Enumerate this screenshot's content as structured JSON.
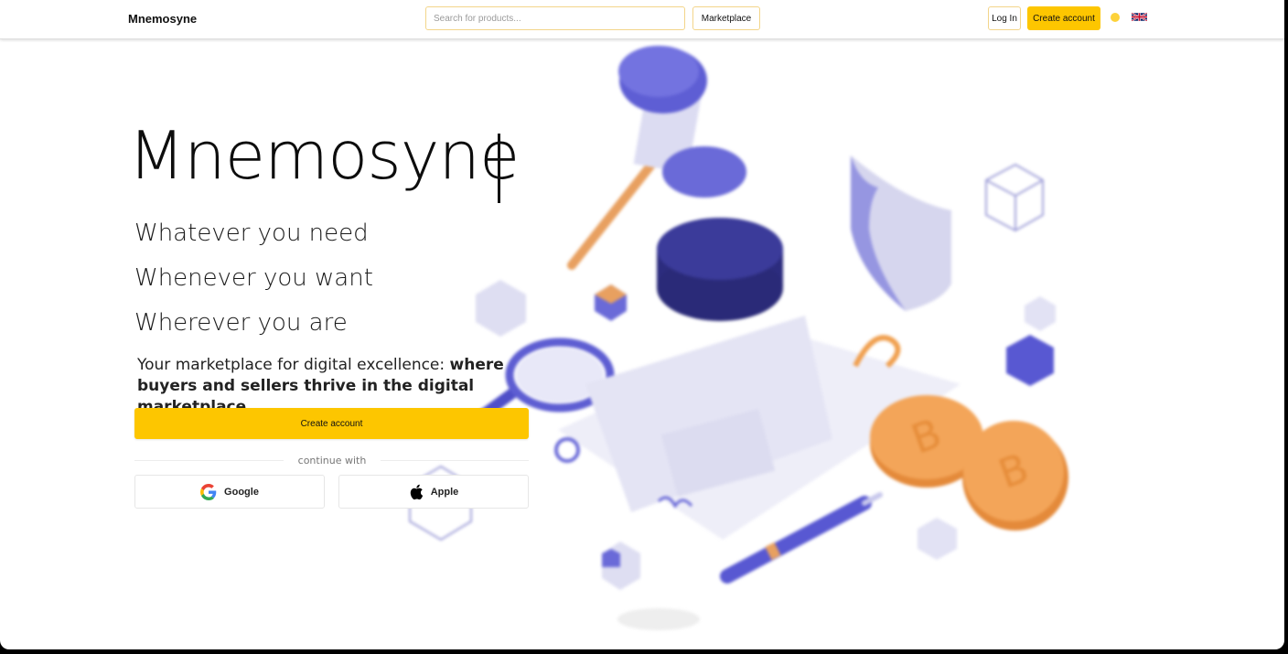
{
  "header": {
    "brand": "Mnemosyne",
    "search_placeholder": "Search for products...",
    "marketplace_label": "Marketplace",
    "login_label": "Log In",
    "create_account_label": "Create account",
    "theme_icon": "sun-dot-icon",
    "language_icon": "uk-flag-icon"
  },
  "hero": {
    "title": "Mnemosyne",
    "lines": [
      "Whatever you need",
      "Whenever you want",
      "Wherever you are"
    ],
    "tagline_plain": "Your marketplace for digital excellence: ",
    "tagline_bold": "where buyers and sellers thrive in the digital marketplace.",
    "cta_label": "Create account",
    "continue_with": "continue with",
    "google_label": "Google",
    "apple_label": "Apple"
  },
  "colors": {
    "accent": "#fdc600",
    "illustration_primary": "#5b5bd6",
    "coin": "#f0a050"
  }
}
